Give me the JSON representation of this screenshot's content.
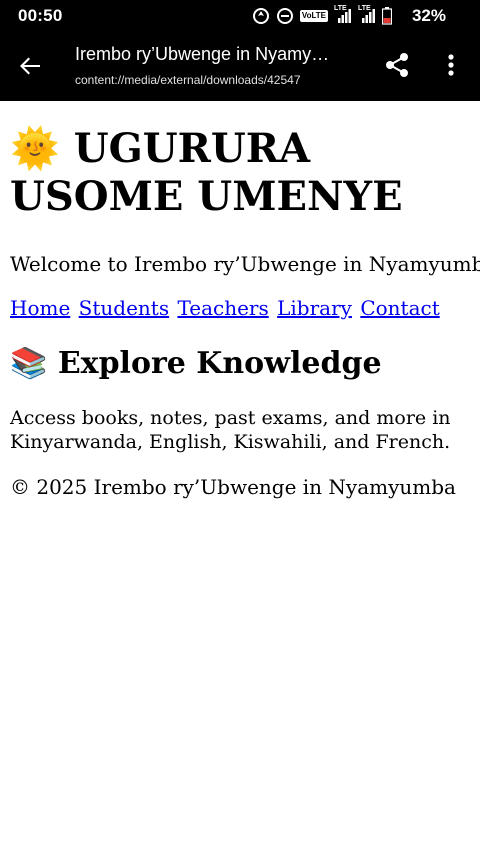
{
  "status_bar": {
    "time": "00:50",
    "network_badge": "VoLTE",
    "lte1": "LTE",
    "lte2": "LTE",
    "battery_percent": "32%"
  },
  "app_bar": {
    "title": "Irembo ry’Ubwenge in Nyamy…",
    "subtitle": "content://media/external/downloads/42547",
    "icons": [
      "back-arrow-icon",
      "share-icon",
      "more-vert-icon"
    ]
  },
  "page": {
    "heading_emoji": "🌞",
    "heading": "UGURURA USOME UMENYE",
    "welcome": "Welcome to Irembo ry’Ubwenge in Nyamyumba",
    "nav": [
      {
        "label": "Home"
      },
      {
        "label": "Students"
      },
      {
        "label": "Teachers"
      },
      {
        "label": "Library"
      },
      {
        "label": "Contact"
      }
    ],
    "section_emoji": "📚",
    "section_title": "Explore Knowledge",
    "section_text": "Access books, notes, past exams, and more in Kinyarwanda, English, Kiswahili, and French.",
    "footer": "© 2025 Irembo ry’Ubwenge in Nyamyumba"
  },
  "colors": {
    "link": "#0000ee",
    "bars": "#000000"
  }
}
